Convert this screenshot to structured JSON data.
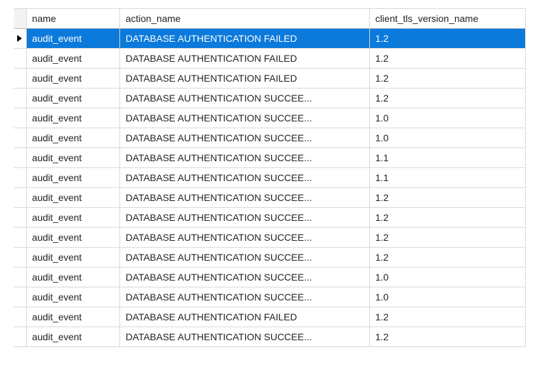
{
  "table": {
    "columns": {
      "name": "name",
      "action": "action_name",
      "tls": "client_tls_version_name"
    },
    "rows": [
      {
        "name": "audit_event",
        "action": "DATABASE AUTHENTICATION FAILED",
        "tls": "1.2",
        "selected": true
      },
      {
        "name": "audit_event",
        "action": "DATABASE AUTHENTICATION FAILED",
        "tls": "1.2",
        "selected": false
      },
      {
        "name": "audit_event",
        "action": "DATABASE AUTHENTICATION FAILED",
        "tls": "1.2",
        "selected": false
      },
      {
        "name": "audit_event",
        "action": "DATABASE AUTHENTICATION SUCCEE...",
        "tls": "1.2",
        "selected": false
      },
      {
        "name": "audit_event",
        "action": "DATABASE AUTHENTICATION SUCCEE...",
        "tls": "1.0",
        "selected": false
      },
      {
        "name": "audit_event",
        "action": "DATABASE AUTHENTICATION SUCCEE...",
        "tls": "1.0",
        "selected": false
      },
      {
        "name": "audit_event",
        "action": "DATABASE AUTHENTICATION SUCCEE...",
        "tls": "1.1",
        "selected": false
      },
      {
        "name": "audit_event",
        "action": "DATABASE AUTHENTICATION SUCCEE...",
        "tls": "1.1",
        "selected": false
      },
      {
        "name": "audit_event",
        "action": "DATABASE AUTHENTICATION SUCCEE...",
        "tls": "1.2",
        "selected": false
      },
      {
        "name": "audit_event",
        "action": "DATABASE AUTHENTICATION SUCCEE...",
        "tls": "1.2",
        "selected": false
      },
      {
        "name": "audit_event",
        "action": "DATABASE AUTHENTICATION SUCCEE...",
        "tls": "1.2",
        "selected": false
      },
      {
        "name": "audit_event",
        "action": "DATABASE AUTHENTICATION SUCCEE...",
        "tls": "1.2",
        "selected": false
      },
      {
        "name": "audit_event",
        "action": "DATABASE AUTHENTICATION SUCCEE...",
        "tls": "1.0",
        "selected": false
      },
      {
        "name": "audit_event",
        "action": "DATABASE AUTHENTICATION SUCCEE...",
        "tls": "1.0",
        "selected": false
      },
      {
        "name": "audit_event",
        "action": "DATABASE AUTHENTICATION FAILED",
        "tls": "1.2",
        "selected": false
      },
      {
        "name": "audit_event",
        "action": "DATABASE AUTHENTICATION SUCCEE...",
        "tls": "1.2",
        "selected": false
      }
    ]
  }
}
